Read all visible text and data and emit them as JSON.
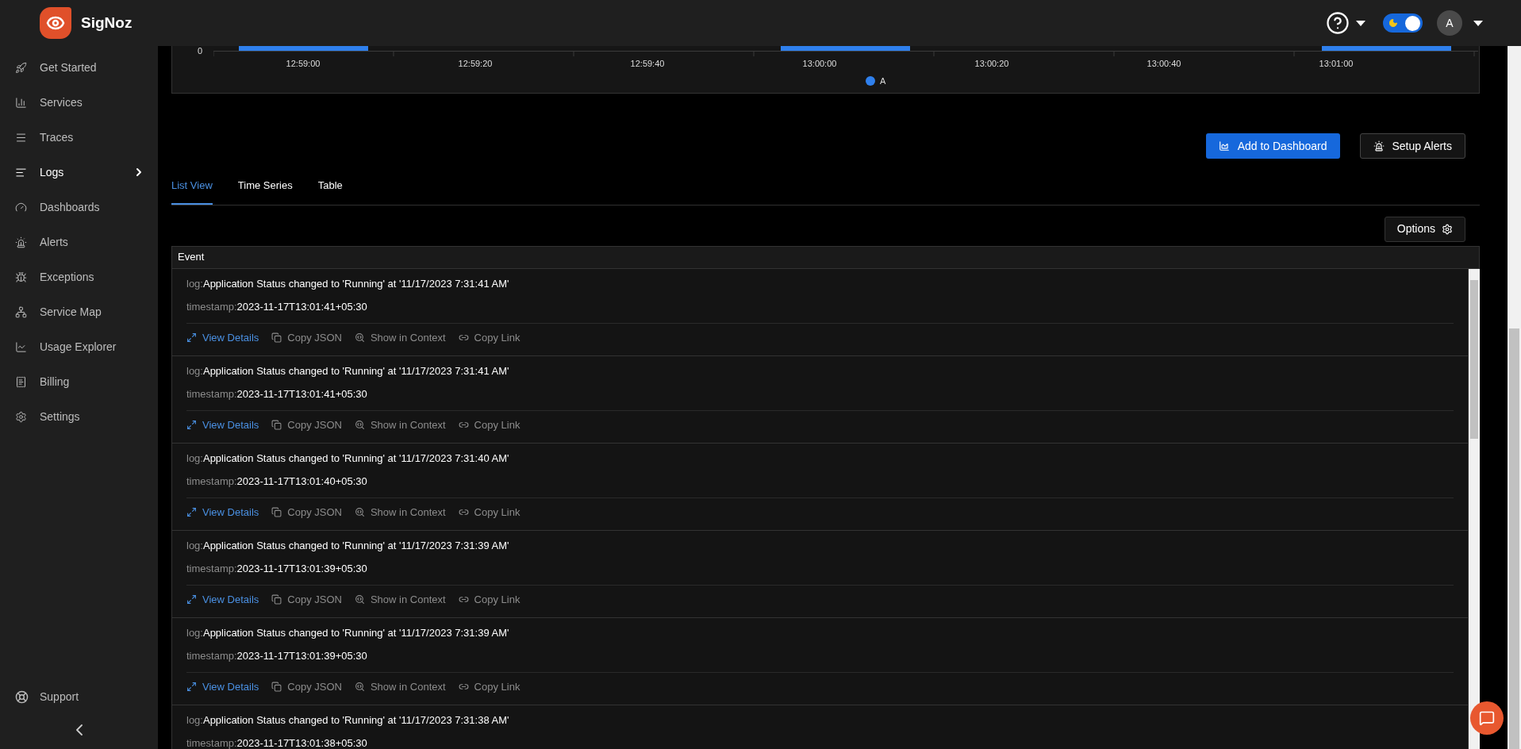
{
  "brand": {
    "name": "SigNoz"
  },
  "header": {
    "theme_toggle": {
      "on": true
    },
    "avatar": "A"
  },
  "sidebar": {
    "items": [
      {
        "kind": "rocket",
        "label": "Get Started",
        "selected": false
      },
      {
        "kind": "bars",
        "label": "Services",
        "selected": false
      },
      {
        "kind": "lines",
        "label": "Traces",
        "selected": false
      },
      {
        "kind": "logs",
        "label": "Logs",
        "selected": true
      },
      {
        "kind": "gauge",
        "label": "Dashboards",
        "selected": false
      },
      {
        "kind": "alarm",
        "label": "Alerts",
        "selected": false
      },
      {
        "kind": "bug",
        "label": "Exceptions",
        "selected": false
      },
      {
        "kind": "map",
        "label": "Service Map",
        "selected": false
      },
      {
        "kind": "chart",
        "label": "Usage Explorer",
        "selected": false
      },
      {
        "kind": "bill",
        "label": "Billing",
        "selected": false
      },
      {
        "kind": "settings",
        "label": "Settings",
        "selected": false
      }
    ],
    "support": "Support"
  },
  "chart": {
    "y_tick": "0",
    "x_labels": [
      "12:59:00",
      "12:59:20",
      "12:59:40",
      "13:00:00",
      "13:00:20",
      "13:00:40",
      "13:01:00"
    ],
    "legend": [
      {
        "name": "A",
        "color": "#2f80ed"
      }
    ]
  },
  "actions": [
    "Add to Dashboard",
    "Setup Alerts"
  ],
  "tabs": [
    {
      "label": "List View",
      "selected": true
    },
    {
      "label": "Time Series",
      "selected": false
    },
    {
      "label": "Table",
      "selected": false
    }
  ],
  "options_button": "Options",
  "table": {
    "column": "Event",
    "rows": [
      {
        "log_label": "log:",
        "log": "Application Status changed to 'Running' at '11/17/2023 7:31:41 AM'",
        "ts_label": "timestamp:",
        "timestamp": "2023-11-17T13:01:41+05:30",
        "actions": [
          "View Details",
          "Copy JSON",
          "Show in Context",
          "Copy Link"
        ]
      },
      {
        "log_label": "log:",
        "log": "Application Status changed to 'Running' at '11/17/2023 7:31:41 AM'",
        "ts_label": "timestamp:",
        "timestamp": "2023-11-17T13:01:41+05:30",
        "actions": [
          "View Details",
          "Copy JSON",
          "Show in Context",
          "Copy Link"
        ]
      },
      {
        "log_label": "log:",
        "log": "Application Status changed to 'Running' at '11/17/2023 7:31:40 AM'",
        "ts_label": "timestamp:",
        "timestamp": "2023-11-17T13:01:40+05:30",
        "actions": [
          "View Details",
          "Copy JSON",
          "Show in Context",
          "Copy Link"
        ]
      },
      {
        "log_label": "log:",
        "log": "Application Status changed to 'Running' at '11/17/2023 7:31:39 AM'",
        "ts_label": "timestamp:",
        "timestamp": "2023-11-17T13:01:39+05:30",
        "actions": [
          "View Details",
          "Copy JSON",
          "Show in Context",
          "Copy Link"
        ]
      },
      {
        "log_label": "log:",
        "log": "Application Status changed to 'Running' at '11/17/2023 7:31:39 AM'",
        "ts_label": "timestamp:",
        "timestamp": "2023-11-17T13:01:39+05:30",
        "actions": [
          "View Details",
          "Copy JSON",
          "Show in Context",
          "Copy Link"
        ]
      },
      {
        "log_label": "log:",
        "log": "Application Status changed to 'Running' at '11/17/2023 7:31:38 AM'",
        "ts_label": "timestamp:",
        "timestamp": "2023-11-17T13:01:38+05:30"
      }
    ]
  }
}
